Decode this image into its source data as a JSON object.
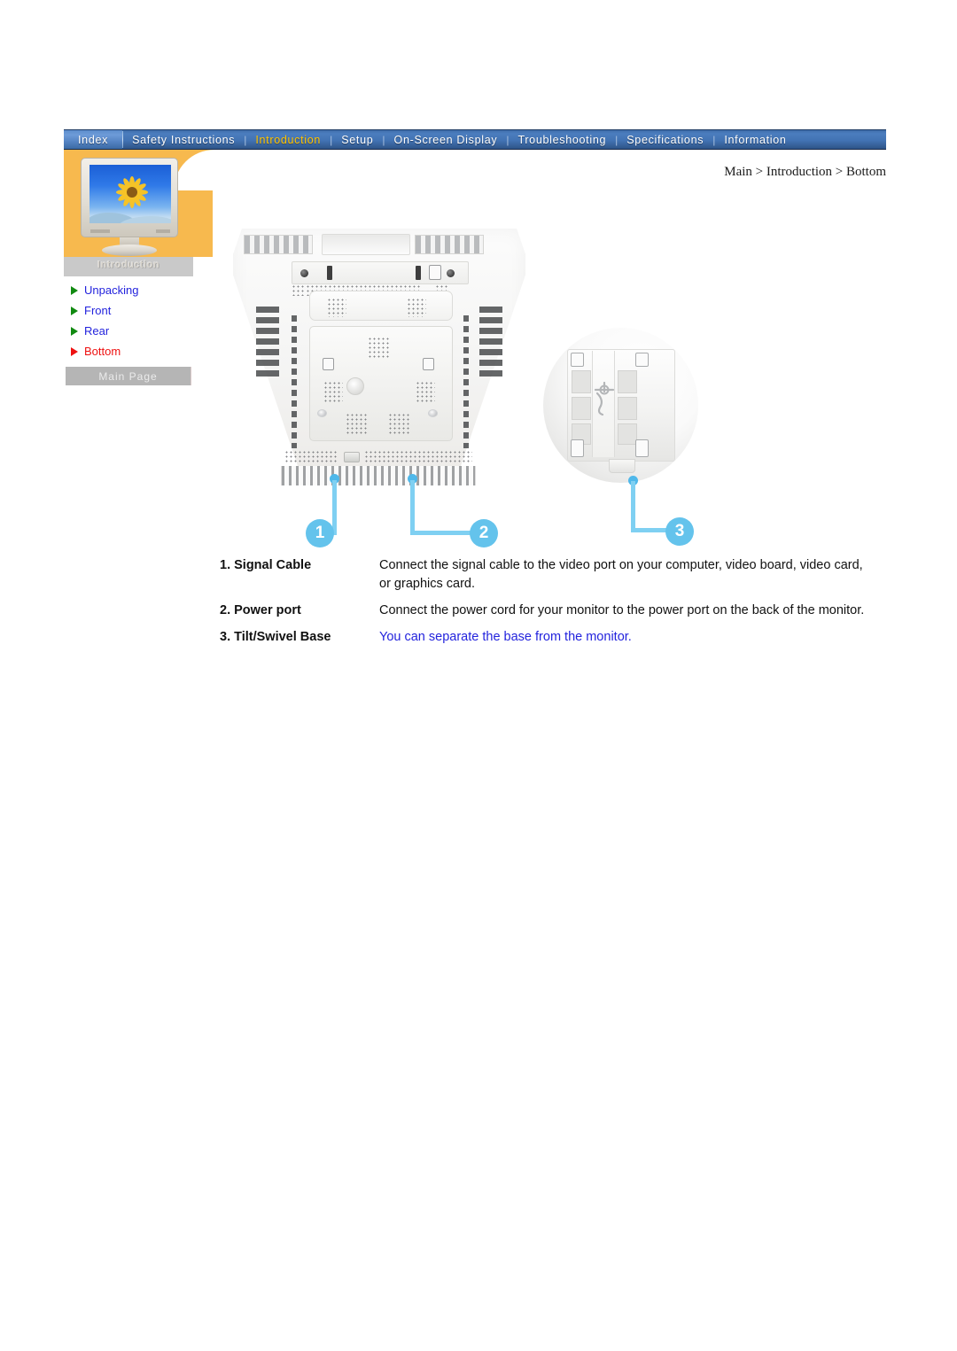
{
  "nav": {
    "items": [
      {
        "label": "Index",
        "state": "first"
      },
      {
        "label": "Safety Instructions",
        "state": "normal"
      },
      {
        "label": "Introduction",
        "state": "active"
      },
      {
        "label": "Setup",
        "state": "normal"
      },
      {
        "label": "On-Screen Display",
        "state": "normal"
      },
      {
        "label": "Troubleshooting",
        "state": "normal"
      },
      {
        "label": "Specifications",
        "state": "normal"
      },
      {
        "label": "Information",
        "state": "normal"
      }
    ],
    "separator": "|"
  },
  "breadcrumb": {
    "text": "Main > Introduction > Bottom"
  },
  "sidebar": {
    "section_label": "Introduction",
    "thumbnail_alt": "monitor-with-sunflower-wallpaper",
    "items": [
      {
        "label": "Unpacking",
        "active": false
      },
      {
        "label": "Front",
        "active": false
      },
      {
        "label": "Rear",
        "active": false
      },
      {
        "label": "Bottom",
        "active": true
      }
    ],
    "main_page_label": "Main Page"
  },
  "figure": {
    "callouts": [
      {
        "number": "1"
      },
      {
        "number": "2"
      },
      {
        "number": "3"
      }
    ]
  },
  "descriptions": [
    {
      "term": "1. Signal Cable",
      "definition": "Connect the signal cable to the video port on your computer, video board, video card, or graphics card.",
      "is_link": false
    },
    {
      "term": "2. Power port",
      "definition": "Connect the power cord for your monitor to the power port on the back of the monitor.",
      "is_link": false
    },
    {
      "term": "3. Tilt/Swivel Base",
      "definition": "You can separate the base from the monitor.",
      "is_link": true
    }
  ],
  "colors": {
    "nav_blue": "#4273b4",
    "nav_active_text": "#ffc400",
    "sidebar_orange": "#f7b94e",
    "link_blue": "#2323dd",
    "active_red": "#ee1111",
    "bullet_green": "#118a11",
    "callout_blue": "#64c3ec",
    "button_gray": "#b5b5b5"
  }
}
